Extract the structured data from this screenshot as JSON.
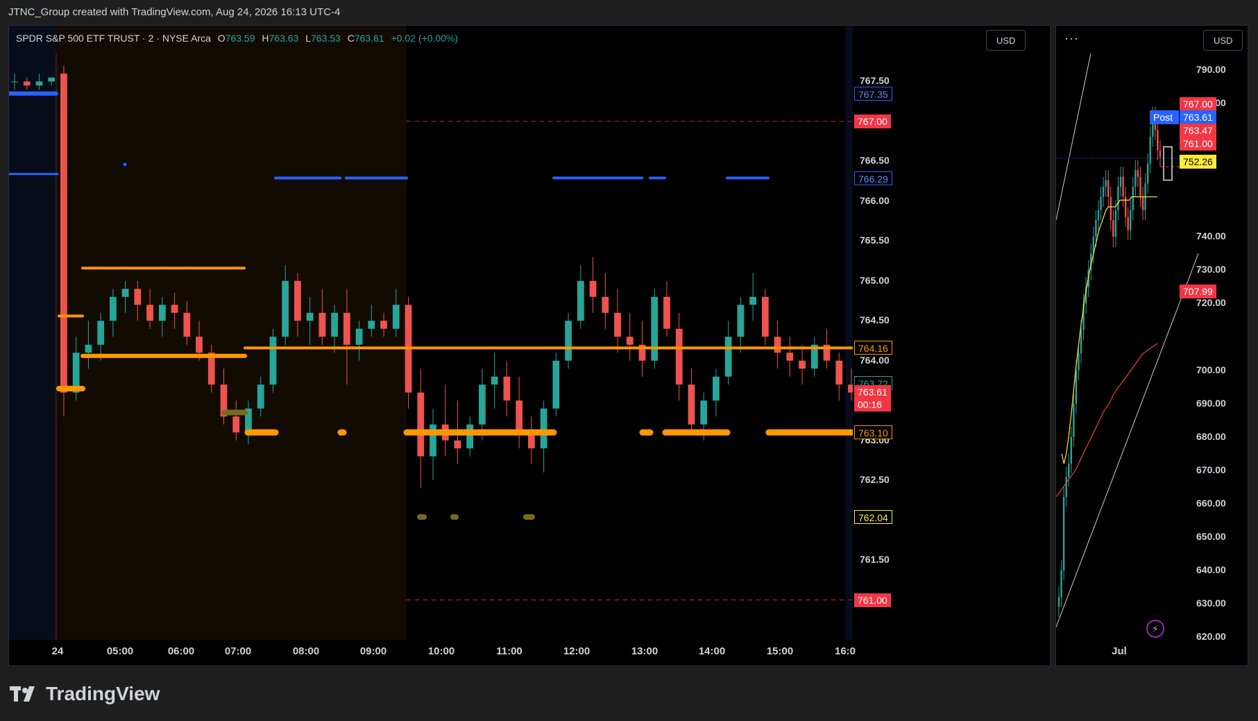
{
  "header": {
    "attribution": "JTNC_Group created with TradingView.com, Aug 24, 2026 16:13 UTC-4"
  },
  "legend": {
    "symbol": "SPDR S&P 500 ETF TRUST · 2 · NYSE Arca",
    "o_label": "O",
    "o_value": "763.59",
    "h_label": "H",
    "h_value": "763.63",
    "l_label": "L",
    "l_value": "763.53",
    "c_label": "C",
    "c_value": "763.61",
    "change": "+0.02 (+0.00%)"
  },
  "currency": "USD",
  "more_menu": "···",
  "footer": {
    "brand": "TradingView"
  },
  "colors": {
    "up": "#26a69a",
    "down": "#ef5350",
    "orange": "#ff9800",
    "blue": "#2962ff",
    "red_tag": "#f23645",
    "yellow": "#ffeb3b",
    "olive": "#7a6b1a"
  },
  "chart_data": [
    {
      "type": "candlestick",
      "interval": "2",
      "symbol": "SPDR S&P 500 ETF TRUST",
      "exchange": "NYSE Arca",
      "x_ticks": [
        "24",
        "05:00",
        "06:00",
        "07:00",
        "08:00",
        "09:00",
        "10:00",
        "11:00",
        "12:00",
        "13:00",
        "14:00",
        "15:00",
        "16:0"
      ],
      "y_ticks": [
        "767.50",
        "766.50",
        "766.00",
        "765.50",
        "765.00",
        "764.50",
        "764.00",
        "763.00",
        "762.50",
        "761.50"
      ],
      "ylim": [
        760.5,
        768.2
      ],
      "ohlc_series": [
        [
          767.5,
          767.6,
          767.4,
          767.5
        ],
        [
          767.5,
          767.55,
          767.4,
          767.45
        ],
        [
          767.45,
          767.6,
          767.4,
          767.5
        ],
        [
          767.5,
          767.55,
          767.45,
          767.55
        ],
        [
          767.6,
          767.7,
          763.3,
          763.6
        ],
        [
          763.6,
          764.3,
          763.5,
          764.1
        ],
        [
          764.1,
          764.5,
          763.9,
          764.2
        ],
        [
          764.2,
          764.6,
          764.0,
          764.5
        ],
        [
          764.5,
          764.9,
          764.3,
          764.8
        ],
        [
          764.8,
          765.0,
          764.6,
          764.9
        ],
        [
          764.9,
          765.0,
          764.5,
          764.7
        ],
        [
          764.7,
          764.9,
          764.4,
          764.5
        ],
        [
          764.5,
          764.8,
          764.3,
          764.7
        ],
        [
          764.7,
          764.85,
          764.4,
          764.6
        ],
        [
          764.6,
          764.75,
          764.2,
          764.3
        ],
        [
          764.3,
          764.5,
          764.0,
          764.1
        ],
        [
          764.1,
          764.2,
          763.6,
          763.7
        ],
        [
          763.7,
          763.9,
          763.2,
          763.3
        ],
        [
          763.3,
          763.5,
          763.0,
          763.1
        ],
        [
          763.1,
          763.5,
          762.95,
          763.4
        ],
        [
          763.4,
          763.8,
          763.3,
          763.7
        ],
        [
          763.7,
          764.4,
          763.6,
          764.3
        ],
        [
          764.3,
          765.2,
          764.2,
          765.0
        ],
        [
          765.0,
          765.1,
          764.3,
          764.5
        ],
        [
          764.5,
          764.8,
          764.2,
          764.6
        ],
        [
          764.6,
          764.9,
          764.2,
          764.3
        ],
        [
          764.3,
          764.7,
          764.1,
          764.6
        ],
        [
          764.6,
          764.9,
          763.7,
          764.2
        ],
        [
          764.2,
          764.5,
          764.0,
          764.4
        ],
        [
          764.4,
          764.7,
          764.3,
          764.5
        ],
        [
          764.5,
          764.6,
          764.3,
          764.4
        ],
        [
          764.4,
          764.9,
          764.3,
          764.7
        ],
        [
          764.7,
          764.8,
          763.4,
          763.6
        ],
        [
          763.6,
          763.9,
          762.4,
          762.8
        ],
        [
          762.8,
          763.4,
          762.5,
          763.2
        ],
        [
          763.2,
          763.7,
          762.8,
          763.0
        ],
        [
          763.0,
          763.5,
          762.7,
          762.9
        ],
        [
          762.9,
          763.3,
          762.8,
          763.2
        ],
        [
          763.2,
          763.9,
          763.0,
          763.7
        ],
        [
          763.7,
          764.1,
          763.4,
          763.8
        ],
        [
          763.8,
          764.0,
          763.3,
          763.5
        ],
        [
          763.5,
          763.8,
          762.9,
          763.1
        ],
        [
          763.1,
          763.3,
          762.7,
          762.9
        ],
        [
          762.9,
          763.5,
          762.6,
          763.4
        ],
        [
          763.4,
          764.1,
          763.3,
          764.0
        ],
        [
          764.0,
          764.6,
          763.9,
          764.5
        ],
        [
          764.5,
          765.2,
          764.4,
          765.0
        ],
        [
          765.0,
          765.3,
          764.6,
          764.8
        ],
        [
          764.8,
          765.1,
          764.4,
          764.6
        ],
        [
          764.6,
          764.9,
          764.1,
          764.3
        ],
        [
          764.3,
          764.6,
          764.0,
          764.2
        ],
        [
          764.2,
          764.5,
          763.8,
          764.0
        ],
        [
          764.0,
          764.9,
          763.9,
          764.8
        ],
        [
          764.8,
          765.0,
          764.3,
          764.4
        ],
        [
          764.4,
          764.6,
          763.5,
          763.7
        ],
        [
          763.7,
          763.9,
          763.1,
          763.2
        ],
        [
          763.2,
          763.6,
          763.0,
          763.5
        ],
        [
          763.5,
          763.9,
          763.3,
          763.8
        ],
        [
          763.8,
          764.5,
          763.7,
          764.3
        ],
        [
          764.3,
          764.8,
          764.1,
          764.7
        ],
        [
          764.7,
          765.1,
          764.5,
          764.8
        ],
        [
          764.8,
          764.9,
          764.2,
          764.3
        ],
        [
          764.3,
          764.5,
          763.9,
          764.1
        ],
        [
          764.1,
          764.3,
          763.8,
          764.0
        ],
        [
          764.0,
          764.2,
          763.7,
          763.9
        ],
        [
          763.9,
          764.3,
          763.8,
          764.2
        ],
        [
          764.2,
          764.4,
          763.9,
          764.0
        ],
        [
          764.0,
          764.1,
          763.5,
          763.7
        ],
        [
          763.7,
          763.9,
          763.5,
          763.6
        ]
      ],
      "levels": [
        {
          "label": "767.35",
          "value": 767.35
        },
        {
          "label": "767.00",
          "value": 767.0
        },
        {
          "label": "766.29",
          "value": 766.29
        },
        {
          "label": "764.16",
          "value": 764.16
        },
        {
          "label": "763.72",
          "value": 763.72
        },
        {
          "label": "763.61",
          "value": 763.61,
          "countdown": "00:16"
        },
        {
          "label": "763.10",
          "value": 763.1
        },
        {
          "label": "762.04",
          "value": 762.04
        },
        {
          "label": "761.00",
          "value": 761.0
        }
      ]
    },
    {
      "type": "candlestick",
      "x_ticks": [
        "Jul"
      ],
      "y_ticks": [
        "790.00",
        "780.00",
        "740.00",
        "730.00",
        "720.00",
        "700.00",
        "690.00",
        "680.00",
        "670.00",
        "660.00",
        "650.00",
        "640.00",
        "630.00",
        "620.00"
      ],
      "ylim": [
        615,
        795
      ],
      "close_series": [
        632,
        640,
        662,
        668,
        672,
        680,
        690,
        700,
        705,
        712,
        720,
        725,
        730,
        735,
        740,
        745,
        748,
        752,
        755,
        757,
        752,
        745,
        740,
        748,
        755,
        758,
        752,
        746,
        742,
        748,
        755,
        760,
        758,
        752,
        748,
        756,
        762,
        770,
        776,
        772,
        766,
        764
      ],
      "ema_fast": [
        675,
        672,
        675,
        680,
        686,
        693,
        700,
        706,
        712,
        717,
        722,
        726,
        730,
        733,
        736,
        739,
        742,
        744,
        746,
        748,
        749,
        749,
        749,
        749,
        750,
        751,
        751,
        751,
        751,
        751,
        752,
        752,
        752,
        752,
        752,
        752,
        752,
        752,
        752,
        752,
        752,
        752
      ],
      "ema_slow": [
        662,
        664,
        666,
        668,
        670,
        673,
        676,
        679,
        682,
        685,
        688,
        690,
        693,
        695,
        697,
        699,
        701,
        703,
        705,
        706,
        707,
        708
      ],
      "labels": [
        {
          "label": "767.00"
        },
        {
          "label": "763.61"
        },
        {
          "label": "763.47"
        },
        {
          "label": "761.00"
        },
        {
          "label": "752.26"
        },
        {
          "label": "707.99"
        }
      ],
      "post_badge": "Post"
    }
  ]
}
